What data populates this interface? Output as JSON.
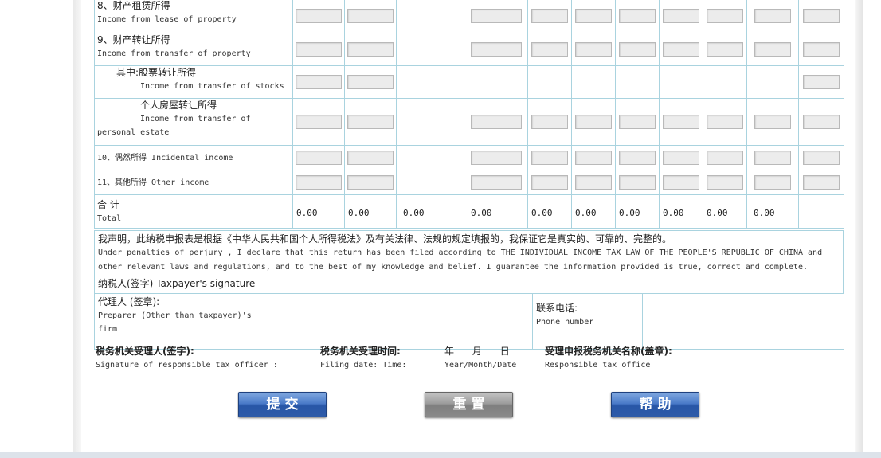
{
  "rows": [
    {
      "zh": "8、财产租赁所得",
      "en": "Income from lease of property"
    },
    {
      "zh": "9、财产转让所得",
      "en": "Income from transfer of property"
    },
    {
      "zh": "其中:股票转让所得",
      "en": "Income from transfer of stocks"
    },
    {
      "zh": "个人房屋转让所得",
      "en1": "Income from transfer of",
      "en2": "personal estate"
    },
    {
      "label": "10、偶然所得 Incidental income"
    },
    {
      "label": "11、其他所得 Other income"
    }
  ],
  "total": {
    "zh": "合 计",
    "en": "Total",
    "values": [
      "0.00",
      "0.00",
      "0.00",
      "0.00",
      "0.00",
      "0.00",
      "0.00",
      "0.00",
      "0.00",
      "0.00"
    ]
  },
  "declaration": {
    "zh": "我声明，此纳税申报表是根据《中华人民共和国个人所得税法》及有关法律、法规的规定填报的，我保证它是真实的、可靠的、完整的。",
    "en_line1": "Under penalties of perjury , I declare that this return has been filed according to THE INDIVIDUAL INCOME TAX LAW OF THE PEOPLE'S REPUBLIC OF CHINA and",
    "en_line2": "other relevant laws and regulations, and to the best of my knowledge and belief. I guarantee the information provided is true, correct and complete.",
    "signature": "纳税人(签字) Taxpayer's signature"
  },
  "preparer": {
    "zh": "代理人 (签章):",
    "en1": "Preparer (Other than taxpayer)'s",
    "en2": "firm",
    "phone_zh": "联系电话:",
    "phone_en": "Phone number"
  },
  "footer": {
    "officer_zh": "税务机关受理人(签字):",
    "officer_en": "Signature of responsible tax officer :",
    "date_zh": "税务机关受理时间:",
    "date_en": "Filing date: Time:",
    "ymd_zh": "年      月      日",
    "ymd_en": "Year/Month/Date",
    "office_zh": "受理申报税务机关名称(盖章):",
    "office_en": "Responsible tax office"
  },
  "buttons": {
    "submit": "提交",
    "reset": "重置",
    "help": "帮助"
  },
  "colors": {
    "border": "#a9d3df",
    "button_blue": "#2d5aa8",
    "button_gray": "#8a8a8a"
  }
}
